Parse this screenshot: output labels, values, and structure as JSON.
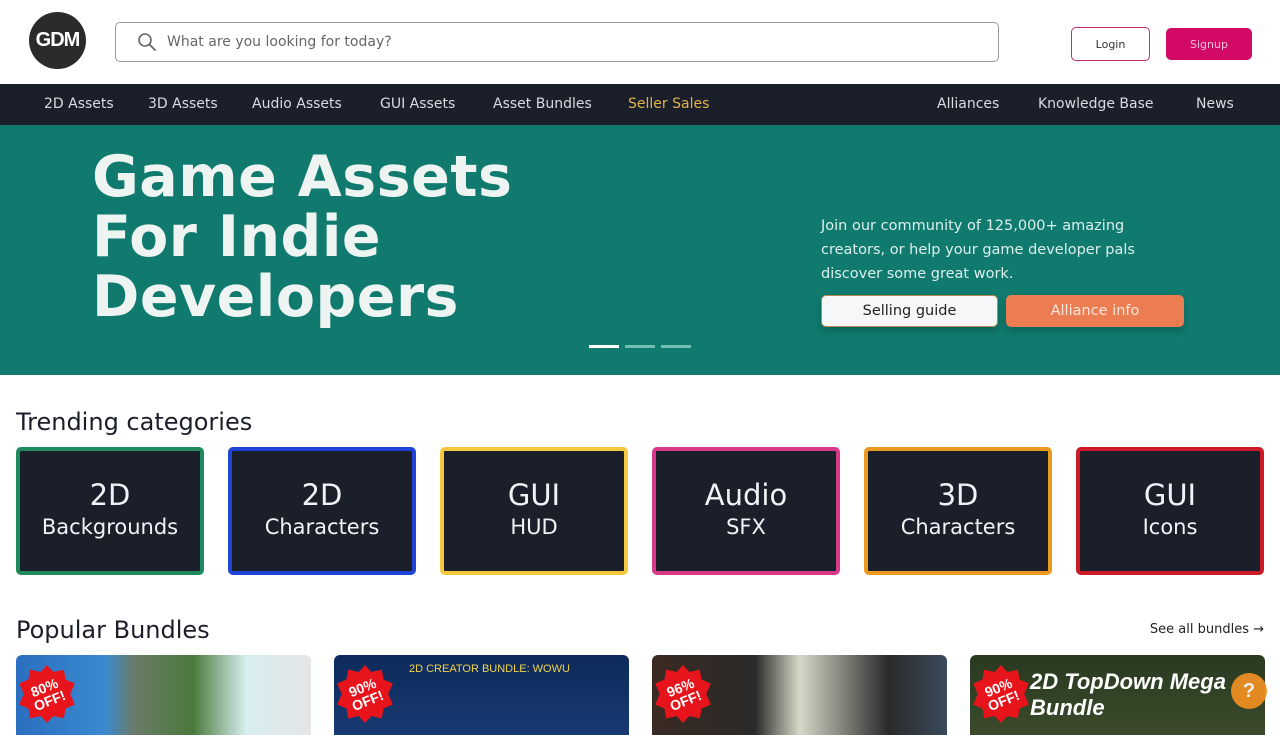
{
  "header": {
    "logo_text": "GDM",
    "search_placeholder": "What are you looking for today?",
    "login_label": "Login",
    "signup_label": "Signup",
    "icons": {
      "search": "search-icon",
      "theme": "moon-icon"
    }
  },
  "nav": {
    "left": [
      {
        "label": "2D Assets"
      },
      {
        "label": "3D Assets"
      },
      {
        "label": "Audio Assets"
      },
      {
        "label": "GUI Assets"
      },
      {
        "label": "Asset Bundles"
      },
      {
        "label": "Seller Sales",
        "highlight": true
      }
    ],
    "right": [
      {
        "label": "Alliances"
      },
      {
        "label": "Knowledge Base"
      },
      {
        "label": "News"
      }
    ]
  },
  "hero": {
    "title_lines": [
      "Game Assets",
      "For Indie",
      "Developers"
    ],
    "description": "Join our community of 125,000+ amazing creators, or help your game developer pals discover some great work.",
    "selling_guide_label": "Selling guide",
    "alliance_info_label": "Alliance info",
    "slides_count": 3,
    "active_slide": 1
  },
  "trending": {
    "title": "Trending categories",
    "categories": [
      {
        "line1": "2D",
        "line2": "Backgrounds",
        "color": "#1f8a5e"
      },
      {
        "line1": "2D",
        "line2": "Characters",
        "color": "#1f45d6"
      },
      {
        "line1": "GUI",
        "line2": "HUD",
        "color": "#f5c842"
      },
      {
        "line1": "Audio",
        "line2": "SFX",
        "color": "#d8398a"
      },
      {
        "line1": "3D",
        "line2": "Characters",
        "color": "#ea9a20"
      },
      {
        "line1": "GUI",
        "line2": "Icons",
        "color": "#cc1a28"
      }
    ]
  },
  "bundles": {
    "title": "Popular Bundles",
    "see_all_label": "See all bundles →",
    "items": [
      {
        "badge": "80% OFF!",
        "title": ""
      },
      {
        "badge": "90% OFF!",
        "title": "2D CREATOR BUNDLE: WOWU"
      },
      {
        "badge": "96% OFF!",
        "title": ""
      },
      {
        "badge": "90% OFF!",
        "title": "2D TopDown Mega Bundle"
      }
    ]
  },
  "help": {
    "label": "?"
  }
}
